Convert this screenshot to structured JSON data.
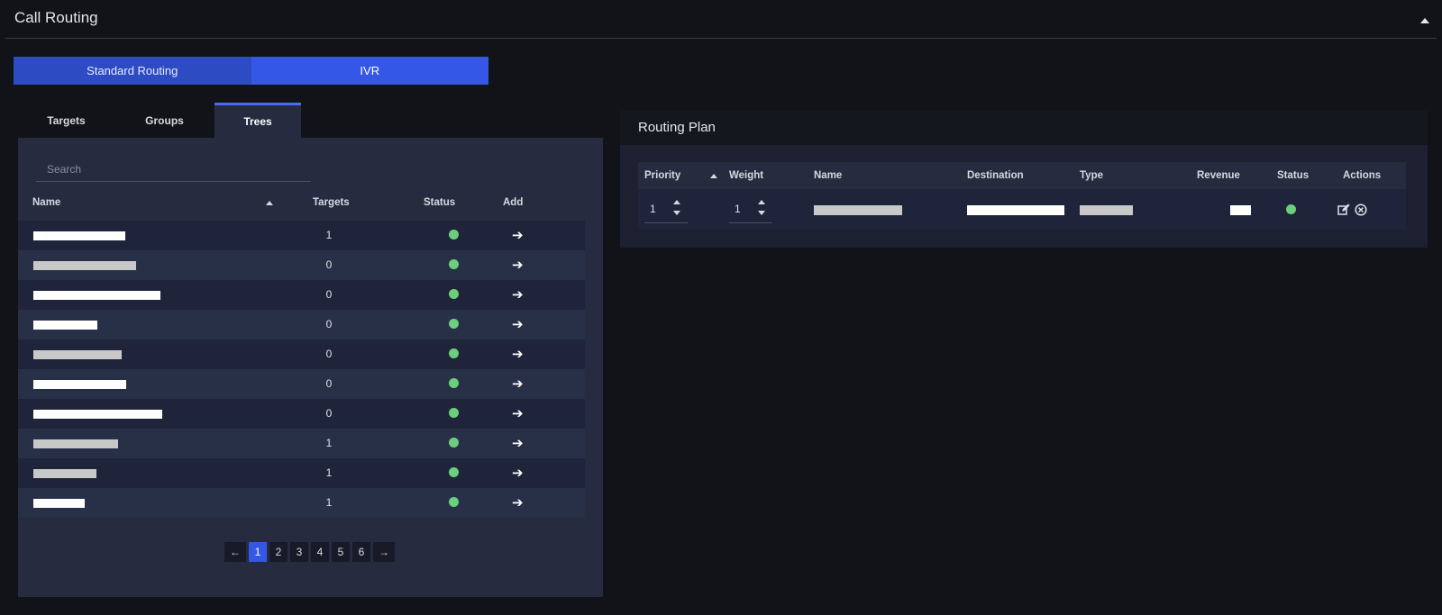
{
  "header": {
    "title": "Call Routing"
  },
  "routing_switch": {
    "standard_label": "Standard Routing",
    "ivr_label": "IVR"
  },
  "tabs": [
    "Targets",
    "Groups",
    "Trees"
  ],
  "left_table": {
    "search_placeholder": "Search",
    "columns": {
      "name": "Name",
      "targets": "Targets",
      "status": "Status",
      "add": "Add"
    },
    "rows": [
      {
        "targets": "1",
        "status": "active"
      },
      {
        "targets": "0",
        "status": "active"
      },
      {
        "targets": "0",
        "status": "active"
      },
      {
        "targets": "0",
        "status": "active"
      },
      {
        "targets": "0",
        "status": "active"
      },
      {
        "targets": "0",
        "status": "active"
      },
      {
        "targets": "0",
        "status": "active"
      },
      {
        "targets": "1",
        "status": "active"
      },
      {
        "targets": "1",
        "status": "active"
      },
      {
        "targets": "1",
        "status": "active"
      }
    ]
  },
  "pagination": {
    "prev": "←",
    "pages": [
      "1",
      "2",
      "3",
      "4",
      "5",
      "6"
    ],
    "current": "1",
    "next": "→"
  },
  "routing_plan": {
    "title": "Routing Plan",
    "columns": {
      "priority": "Priority",
      "weight": "Weight",
      "name": "Name",
      "destination": "Destination",
      "type": "Type",
      "revenue": "Revenue",
      "status": "Status",
      "actions": "Actions"
    },
    "row": {
      "priority": "1",
      "weight": "1",
      "status": "active"
    }
  },
  "colors": {
    "status_active": "#6ccf7c",
    "accent": "#3457e6"
  }
}
